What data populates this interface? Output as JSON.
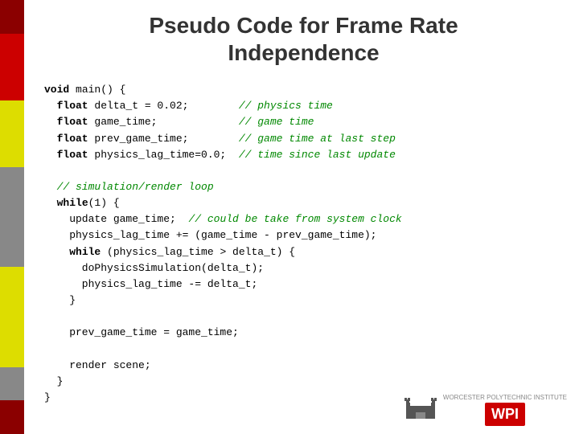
{
  "page": {
    "title_line1": "Pseudo Code for Frame Rate",
    "title_line2": "Independence",
    "background": "#ffffff"
  },
  "colorbar": {
    "colors": [
      "#8B0000",
      "#cc0000",
      "#cc0000",
      "#cccc00",
      "#cccc00",
      "#888888",
      "#888888",
      "#888888",
      "#cccc00",
      "#cccc00",
      "#cccc00",
      "#888888",
      "#8B0000"
    ]
  },
  "code": {
    "lines": [
      {
        "text": "void main() {",
        "parts": [
          {
            "t": "void",
            "cls": "kw"
          },
          {
            "t": " main() {",
            "cls": ""
          }
        ]
      },
      {
        "text": "  float delta_t = 0.02;      // physics time",
        "parts": [
          {
            "t": "  float",
            "cls": "kw"
          },
          {
            "t": " delta_t = 0.02;      ",
            "cls": ""
          },
          {
            "t": "// physics time",
            "cls": "comment"
          }
        ]
      },
      {
        "text": "  float game_time;           // game time",
        "parts": [
          {
            "t": "  float",
            "cls": "kw"
          },
          {
            "t": " game_time;           ",
            "cls": ""
          },
          {
            "t": "// game time",
            "cls": "comment"
          }
        ]
      },
      {
        "text": "  float prev_game_time;      // game time at last step",
        "parts": [
          {
            "t": "  float",
            "cls": "kw"
          },
          {
            "t": " prev_game_time;      ",
            "cls": ""
          },
          {
            "t": "// game time at last step",
            "cls": "comment"
          }
        ]
      },
      {
        "text": "  float physics_lag_time=0.0; // time since last update",
        "parts": [
          {
            "t": "  float",
            "cls": "kw"
          },
          {
            "t": " physics_lag_time=0.0; ",
            "cls": ""
          },
          {
            "t": "// time since last update",
            "cls": "comment"
          }
        ]
      },
      {
        "text": "",
        "parts": []
      },
      {
        "text": "  // simulation/render loop",
        "parts": [
          {
            "t": "  // simulation/render loop",
            "cls": "comment"
          }
        ]
      },
      {
        "text": "  while(1) {",
        "parts": [
          {
            "t": "  ",
            "cls": ""
          },
          {
            "t": "while",
            "cls": "kw"
          },
          {
            "t": "(1) {",
            "cls": ""
          }
        ]
      },
      {
        "text": "    update game_time; // could be take from system clock",
        "parts": [
          {
            "t": "    update game_time; ",
            "cls": ""
          },
          {
            "t": "// could be take from system clock",
            "cls": "comment"
          }
        ]
      },
      {
        "text": "    physics_lag_time += (game_time - prev_game_time);",
        "parts": [
          {
            "t": "    physics_lag_time += (game_time - prev_game_time);",
            "cls": ""
          }
        ]
      },
      {
        "text": "    while (physics_lag_time > delta_t) {",
        "parts": [
          {
            "t": "    ",
            "cls": ""
          },
          {
            "t": "while",
            "cls": "kw"
          },
          {
            "t": " (physics_lag_time > delta_t) {",
            "cls": ""
          }
        ]
      },
      {
        "text": "      doPhysicsSimulation(delta_t);",
        "parts": [
          {
            "t": "      doPhysicsSimulation(delta_t);",
            "cls": ""
          }
        ]
      },
      {
        "text": "      physics_lag_time -= delta_t;",
        "parts": [
          {
            "t": "      physics_lag_time -= delta_t;",
            "cls": ""
          }
        ]
      },
      {
        "text": "    }",
        "parts": [
          {
            "t": "    }",
            "cls": ""
          }
        ]
      },
      {
        "text": "",
        "parts": []
      },
      {
        "text": "    prev_game_time = game_time;",
        "parts": [
          {
            "t": "    prev_game_time = game_time;",
            "cls": ""
          }
        ]
      },
      {
        "text": "",
        "parts": []
      },
      {
        "text": "    render scene;",
        "parts": [
          {
            "t": "    render scene;",
            "cls": ""
          }
        ]
      },
      {
        "text": "  }",
        "parts": [
          {
            "t": "  }",
            "cls": ""
          }
        ]
      },
      {
        "text": "}",
        "parts": [
          {
            "t": "}",
            "cls": ""
          }
        ]
      }
    ]
  },
  "logo": {
    "wpi_text": "WPI",
    "tagline": "WORCESTER POLYTECHNIC INSTITUTE"
  }
}
